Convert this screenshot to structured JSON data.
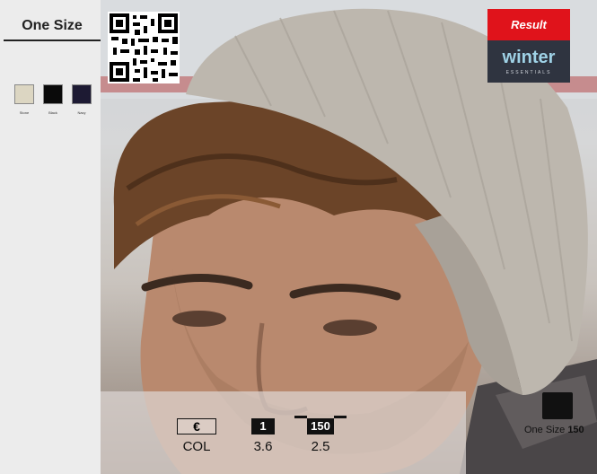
{
  "sidebar": {
    "size_title": "One Size",
    "swatches": [
      {
        "label": "Stone",
        "color": "#dcd6c2"
      },
      {
        "label": "Black",
        "color": "#0a0a0a"
      },
      {
        "label": "Navy",
        "color": "#1d1a33"
      }
    ]
  },
  "brand": {
    "name": "Result",
    "collection": "winter",
    "collection_sub": "ESSENTIALS",
    "accent_color": "#e0131b"
  },
  "pricing": {
    "headers": [
      "€",
      "1",
      "150"
    ],
    "values": [
      "COL",
      "3.6",
      "2.5"
    ]
  },
  "packaging": {
    "label": "One Size",
    "qty": "150"
  }
}
